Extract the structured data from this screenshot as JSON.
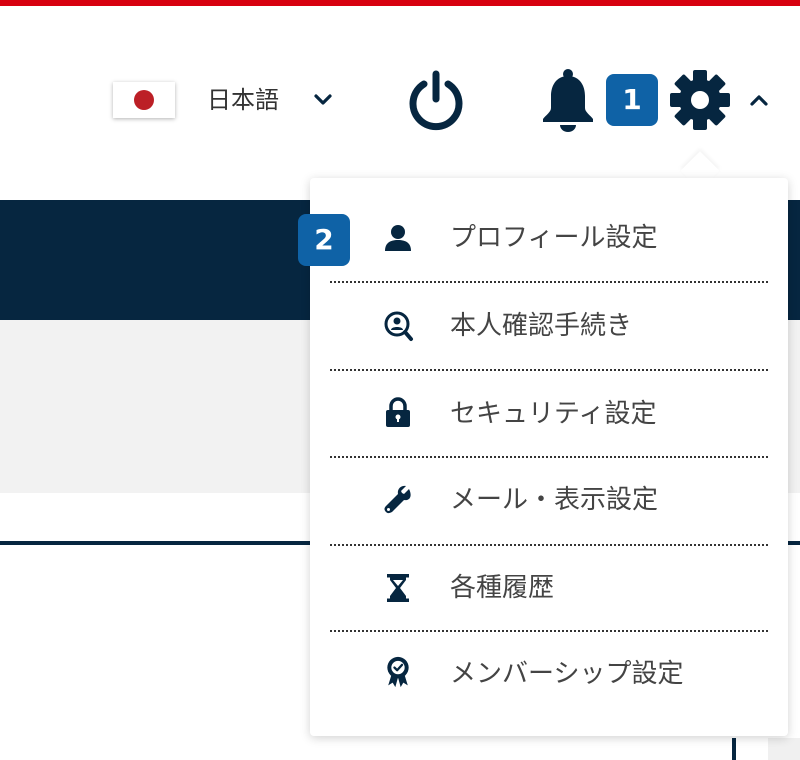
{
  "header": {
    "language": {
      "flag": "japan-flag-icon",
      "label": "日本語",
      "chevron": "chevron-down-icon"
    },
    "icons": [
      "power-icon",
      "bell-icon",
      "gear-icon",
      "chevron-up-icon"
    ],
    "badges": {
      "first": "1",
      "second": "2"
    }
  },
  "settings_menu": {
    "items": [
      {
        "label": "プロフィール設定",
        "icon": "user-icon"
      },
      {
        "label": "本人確認手続き",
        "icon": "identity-search-icon"
      },
      {
        "label": "セキュリティ設定",
        "icon": "lock-icon"
      },
      {
        "label": "メール・表示設定",
        "icon": "wrench-icon"
      },
      {
        "label": "各種履歴",
        "icon": "hourglass-icon"
      },
      {
        "label": "メンバーシップ設定",
        "icon": "award-icon"
      }
    ]
  },
  "colors": {
    "top_stripe": "#d7000f",
    "navy": "#062640",
    "badge_blue": "#0f62a6",
    "flag_red": "#bc1f26",
    "panel_gray": "#f2f2f2"
  }
}
